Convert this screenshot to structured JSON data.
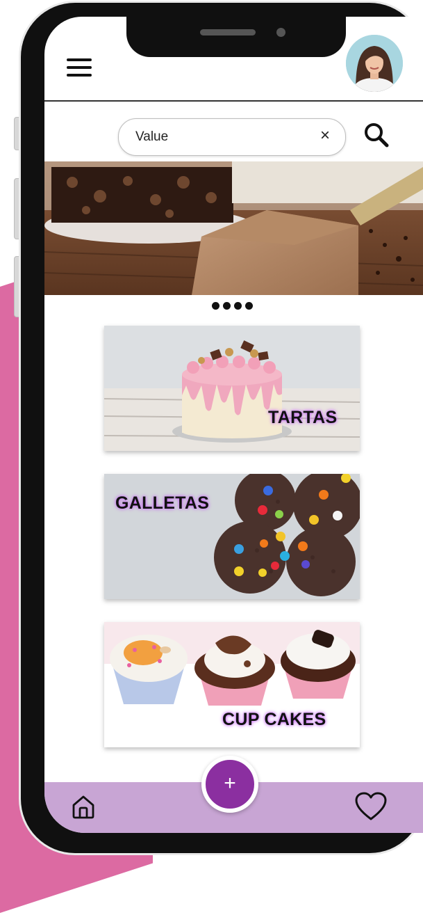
{
  "search": {
    "value": "Value",
    "clear_symbol": "×"
  },
  "banner": {
    "image": "coffee-cheesecake-photo",
    "indicator_count": 4
  },
  "categories": [
    {
      "label": "TARTAS",
      "image": "pink-drip-cake-photo"
    },
    {
      "label": "GALLETAS",
      "image": "chocolate-candy-cookies-photo"
    },
    {
      "label": "CUP CAKES",
      "image": "cupcakes-photo"
    }
  ],
  "bottom_nav": {
    "add_label": "+",
    "home_icon": "home-icon",
    "favorites_icon": "heart-icon"
  },
  "colors": {
    "accent": "#8b2fa0",
    "nav_bar": "#c8a5d4",
    "background_shape": "#dc6aa2"
  }
}
